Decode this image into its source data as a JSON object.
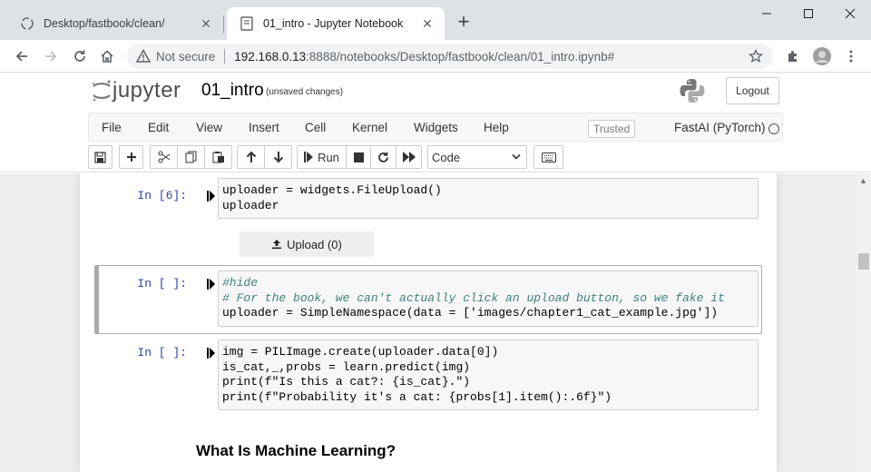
{
  "browser": {
    "tabs": [
      {
        "title": "Desktop/fastbook/clean/",
        "active": false
      },
      {
        "title": "01_intro - Jupyter Notebook",
        "active": true
      }
    ],
    "new_tab_label": "+",
    "security_label": "Not secure",
    "url_host": "192.168.0.13",
    "url_path": ":8888/notebooks/Desktop/fastbook/clean/01_intro.ipynb#"
  },
  "jupyter": {
    "logo_text": "jupyter",
    "notebook_name": "01_intro",
    "autosave_status": "(unsaved changes)",
    "logout_label": "Logout",
    "menu": [
      "File",
      "Edit",
      "View",
      "Insert",
      "Cell",
      "Kernel",
      "Widgets",
      "Help"
    ],
    "trusted_label": "Trusted",
    "kernel_name": "FastAI (PyTorch)",
    "run_label": "Run",
    "cell_type": "Code"
  },
  "cells": [
    {
      "prompt": "In [6]:",
      "lines": [
        "uploader = widgets.FileUpload()",
        "uploader"
      ]
    },
    {
      "prompt": "In [ ]:",
      "lines": [
        "#hide",
        "# For the book, we can't actually click an upload button, so we fake it",
        "uploader = SimpleNamespace(data = ['images/chapter1_cat_example.jpg'])"
      ]
    },
    {
      "prompt": "In [ ]:",
      "lines": [
        "img = PILImage.create(uploader.data[0])",
        "is_cat,_,probs = learn.predict(img)",
        "print(f\"Is this a cat?: {is_cat}.\")",
        "print(f\"Probability it's a cat: {probs[1].item():.6f}\")"
      ]
    }
  ],
  "upload_widget_label": "Upload (0)",
  "markdown_heading": "What Is Machine Learning?",
  "colors": {
    "prompt_blue": "#303f9f",
    "tab_strip": "#dee1e6",
    "cell_input_bg": "#f7f7f7"
  }
}
